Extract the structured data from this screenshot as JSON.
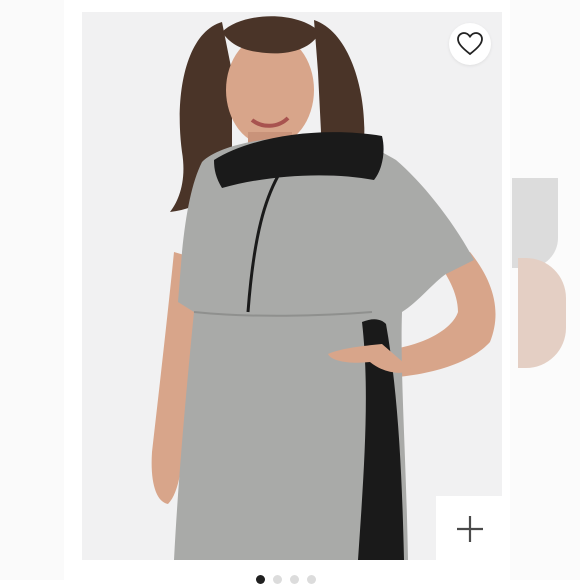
{
  "gallery": {
    "current_index": 1,
    "total_images": 4,
    "accent_color": "#202020",
    "dot_color": "#dcdcdc"
  },
  "icons": {
    "like": "heart-outline-icon",
    "zoom": "plus-icon"
  },
  "colors": {
    "card_background": "#f1f1f2",
    "dress_gray": "#a9aaa8",
    "dress_black": "#1a1a1a",
    "skin": "#d8a58a",
    "hair": "#4a3428"
  }
}
